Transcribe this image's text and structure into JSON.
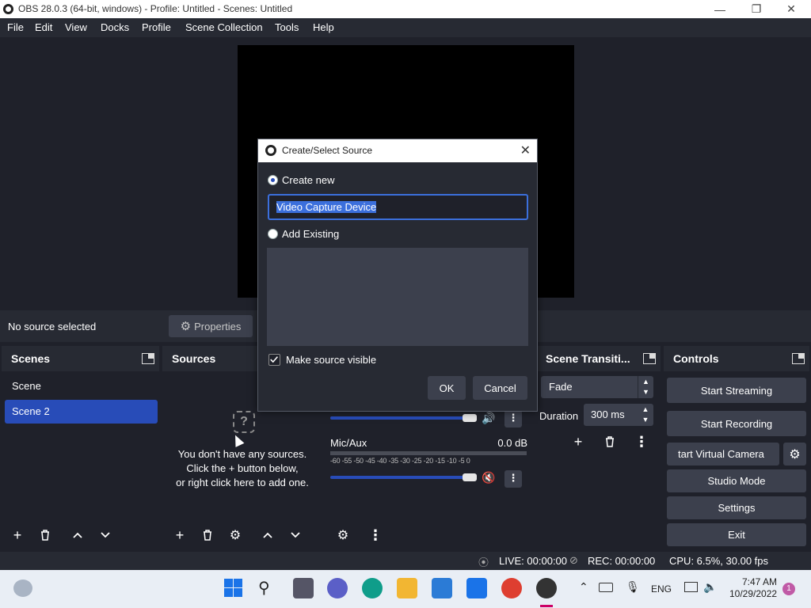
{
  "window": {
    "title": "OBS 28.0.3 (64-bit, windows) - Profile: Untitled - Scenes: Untitled",
    "minimize": "—",
    "maximize": "❐",
    "close": "✕"
  },
  "menu": [
    "File",
    "Edit",
    "View",
    "Docks",
    "Profile",
    "Scene Collection",
    "Tools",
    "Help"
  ],
  "source_info": {
    "status": "No source selected",
    "properties_label": "Properties"
  },
  "scenes": {
    "title": "Scenes",
    "items": [
      "Scene",
      "Scene 2"
    ],
    "selected": "Scene 2"
  },
  "sources": {
    "title": "Sources",
    "empty_line1": "You don't have any sources.",
    "empty_line2": "Click the + button below,",
    "empty_line3": "or right click here to add one."
  },
  "mixer": {
    "channel_name": "Mic/Aux",
    "channel_db": "0.0 dB",
    "ticks": "-60 -55 -50 -45 -40 -35 -30 -25 -20 -15 -10 -5 0"
  },
  "transitions": {
    "title": "Scene Transiti...",
    "selected": "Fade",
    "duration_label": "Duration",
    "duration_value": "300 ms"
  },
  "controls": {
    "title": "Controls",
    "start_streaming": "Start Streaming",
    "start_recording": "Start Recording",
    "start_virtual_camera": "tart Virtual Camera",
    "studio_mode": "Studio Mode",
    "settings": "Settings",
    "exit": "Exit"
  },
  "status": {
    "live": "LIVE: 00:00:00",
    "rec": "REC: 00:00:00",
    "cpu": "CPU: 6.5%, 30.00 fps"
  },
  "dialog": {
    "title": "Create/Select Source",
    "create_new_label": "Create new",
    "name_value": "Video Capture Device",
    "add_existing_label": "Add Existing",
    "make_visible_label": "Make source visible",
    "ok_label": "OK",
    "cancel_label": "Cancel"
  },
  "taskbar": {
    "lang": "ENG",
    "time": "7:47 AM",
    "date": "10/29/2022",
    "notification_count": "1"
  },
  "colors": {
    "accent": "#284cb8",
    "panel": "#272a33",
    "background": "#1f212a",
    "button": "#3c404d"
  }
}
